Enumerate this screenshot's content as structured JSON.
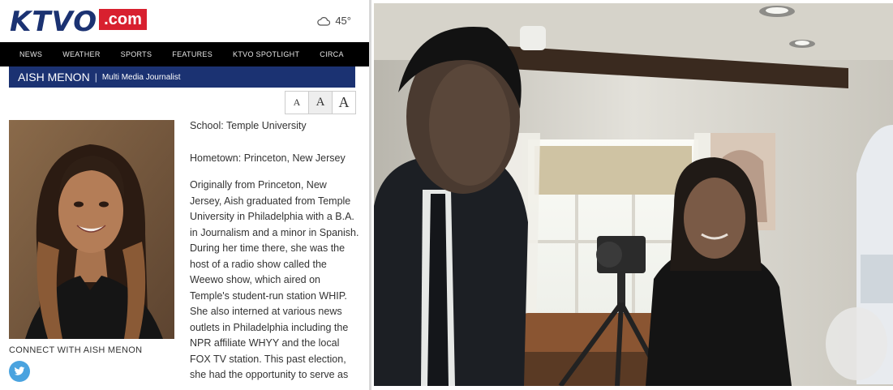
{
  "site": {
    "logo_text": "KTVO",
    "logo_domain": ".com",
    "weather_temp": "45°",
    "weather_icon": "cloud-icon"
  },
  "nav": [
    "News",
    "Weather",
    "Sports",
    "Features",
    "KTVO Spotlight",
    "Circa"
  ],
  "profile": {
    "name": "AISH MENON",
    "role": "Multi Media Journalist",
    "school": "School: Temple University",
    "hometown": "Hometown: Princeton, New Jersey",
    "bio": "Originally from Princeton, New Jersey, Aish graduated from Temple University in Philadelphia with a B.A. in Journalism and a minor in Spanish. During her time there, she was the host of a radio show called the Weewo show, which aired on Temple's student-run station WHIP. She also interned at various news outlets in Philadelphia including the NPR affiliate WHYY and the local FOX TV station. This past election, she had the opportunity to serve as",
    "connect_label": "CONNECT WITH AISH MENON",
    "social_icon": "twitter-icon"
  },
  "text_size": {
    "small": "A",
    "medium": "A",
    "large": "A"
  },
  "colors": {
    "brand_navy": "#1b3272",
    "brand_red": "#d8202f",
    "nav_bg": "#000000",
    "twitter_blue": "#4aa3df"
  }
}
